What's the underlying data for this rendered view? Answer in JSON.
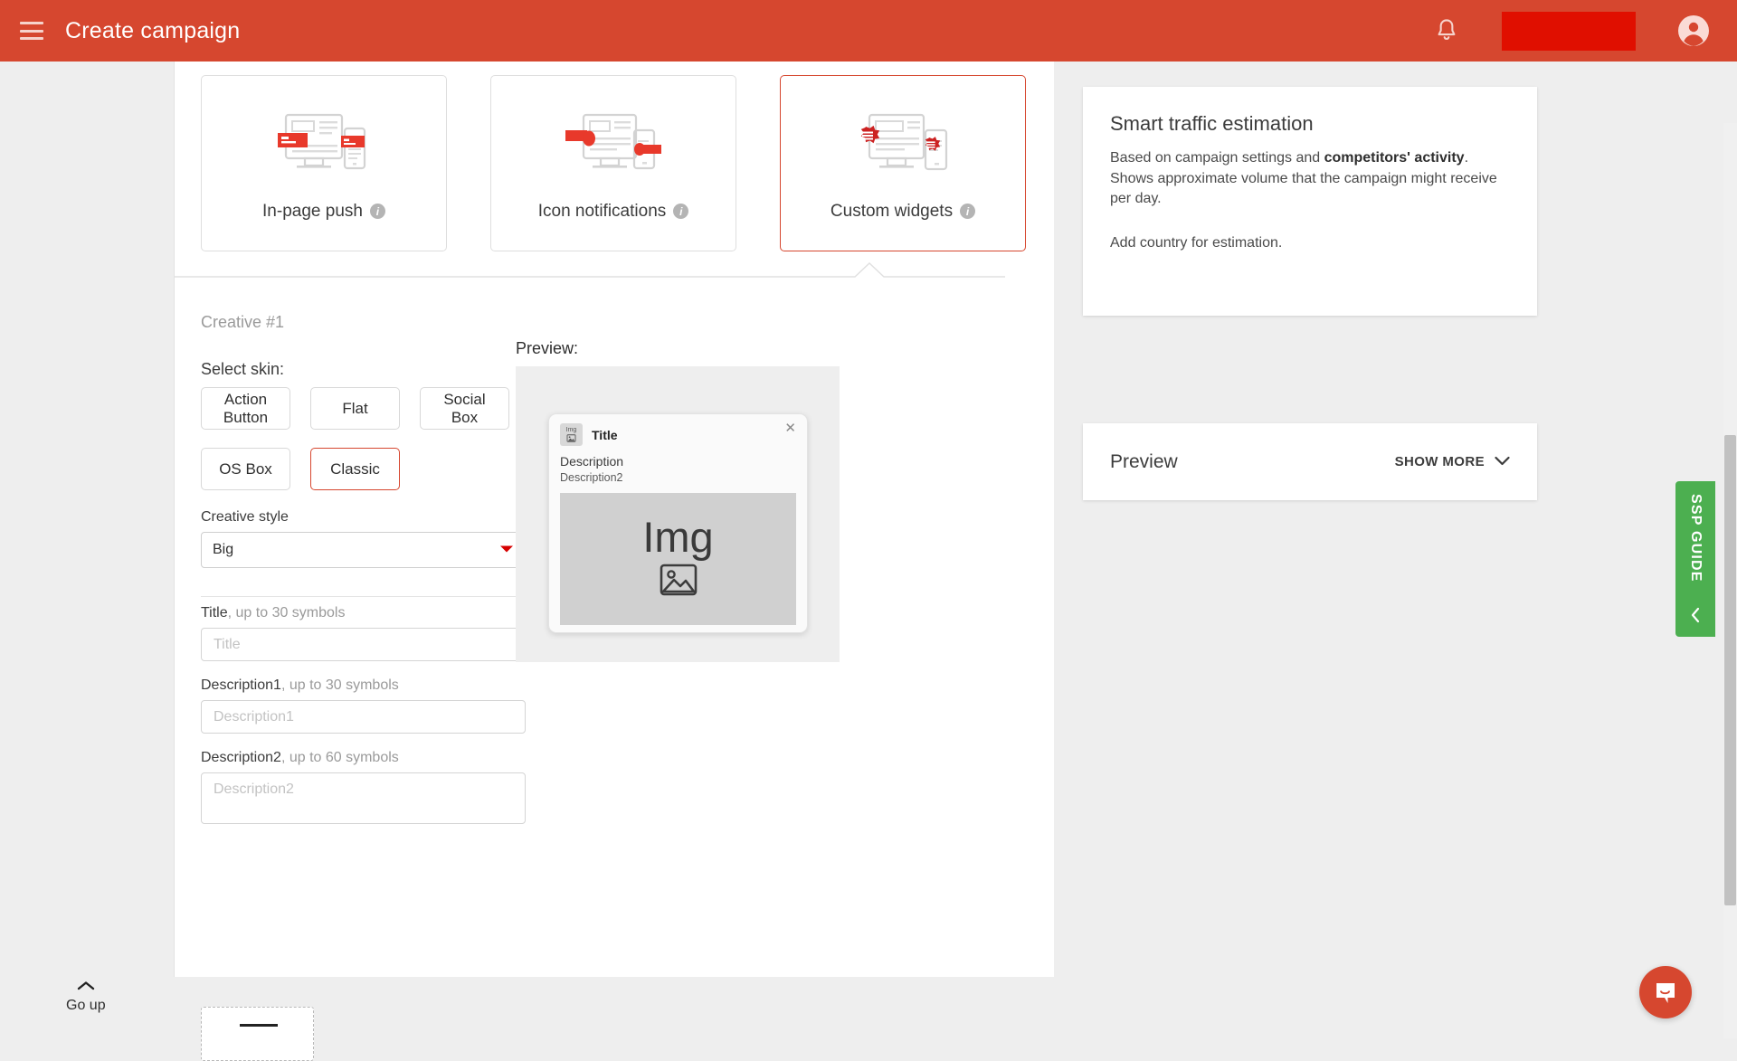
{
  "appbar": {
    "menu_icon": "hamburger-menu-icon",
    "title": "Create campaign",
    "bell_icon": "notification-bell-icon",
    "redacted_label": "",
    "avatar_icon": "account-circle-icon"
  },
  "creative_types": [
    {
      "label": "In-page push",
      "icon": "in-page-push-illustration",
      "info_icon": "info-icon",
      "selected": false
    },
    {
      "label": "Icon notifications",
      "icon": "icon-notifications-illustration",
      "info_icon": "info-icon",
      "selected": false
    },
    {
      "label": "Custom widgets",
      "icon": "custom-widgets-illustration",
      "info_icon": "info-icon",
      "selected": true
    }
  ],
  "creative": {
    "number_label": "Creative #1",
    "select_skin_label": "Select skin:",
    "skins": [
      {
        "label": "Action\nButton",
        "line1": "Action",
        "line2": "Button",
        "selected": false
      },
      {
        "label": "Flat",
        "line1": "Flat",
        "line2": "",
        "selected": false
      },
      {
        "label": "Social Box",
        "line1": "Social Box",
        "line2": "",
        "selected": false
      },
      {
        "label": "OS Box",
        "line1": "OS Box",
        "line2": "",
        "selected": false
      },
      {
        "label": "Classic",
        "line1": "Classic",
        "line2": "",
        "selected": true
      }
    ],
    "style_field": {
      "label": "Creative style",
      "value": "Big",
      "caret_icon": "caret-down-icon"
    },
    "title_field": {
      "label_main": "Title",
      "label_muted": ", up to 30 symbols",
      "placeholder": "Title",
      "value": ""
    },
    "description1_field": {
      "label_main": "Description1",
      "label_muted": ", up to 30 symbols",
      "placeholder": "Description1",
      "value": ""
    },
    "description2_field": {
      "label_main": "Description2",
      "label_muted": ", up to 60 symbols",
      "placeholder": "Description2",
      "value": ""
    },
    "upload_box": {
      "name": "image-upload-dropzone"
    }
  },
  "preview": {
    "label": "Preview:",
    "widget": {
      "thumb_text": "Img",
      "thumb_icon": "image-placeholder-icon",
      "title": "Title",
      "description": "Description",
      "description2": "Description2",
      "close_icon": "close-icon",
      "image_text": "Img",
      "image_icon": "image-placeholder-icon"
    }
  },
  "sidebar": {
    "smart_traffic": {
      "title": "Smart traffic estimation",
      "text_part1": "Based on campaign settings and ",
      "text_bold": "competitors' activity",
      "text_part2": ". Shows approximate volume that the campaign might receive per day.",
      "text_secondary": "Add country for estimation."
    },
    "preview_panel": {
      "title": "Preview",
      "show_more_label": "SHOW MORE",
      "chevron_icon": "chevron-down-icon"
    }
  },
  "ssp_guide": {
    "label": "SSP GUIDE",
    "chevron_icon": "chevron-left-icon"
  },
  "go_up": {
    "label": "Go up",
    "chevron_icon": "chevron-up-icon"
  },
  "chat": {
    "icon": "chat-bubble-icon"
  },
  "colors": {
    "brand_red": "#d6472f",
    "accent_red": "#e00f00",
    "ssp_green": "#4caf50",
    "page_bg": "#eeeeee"
  }
}
